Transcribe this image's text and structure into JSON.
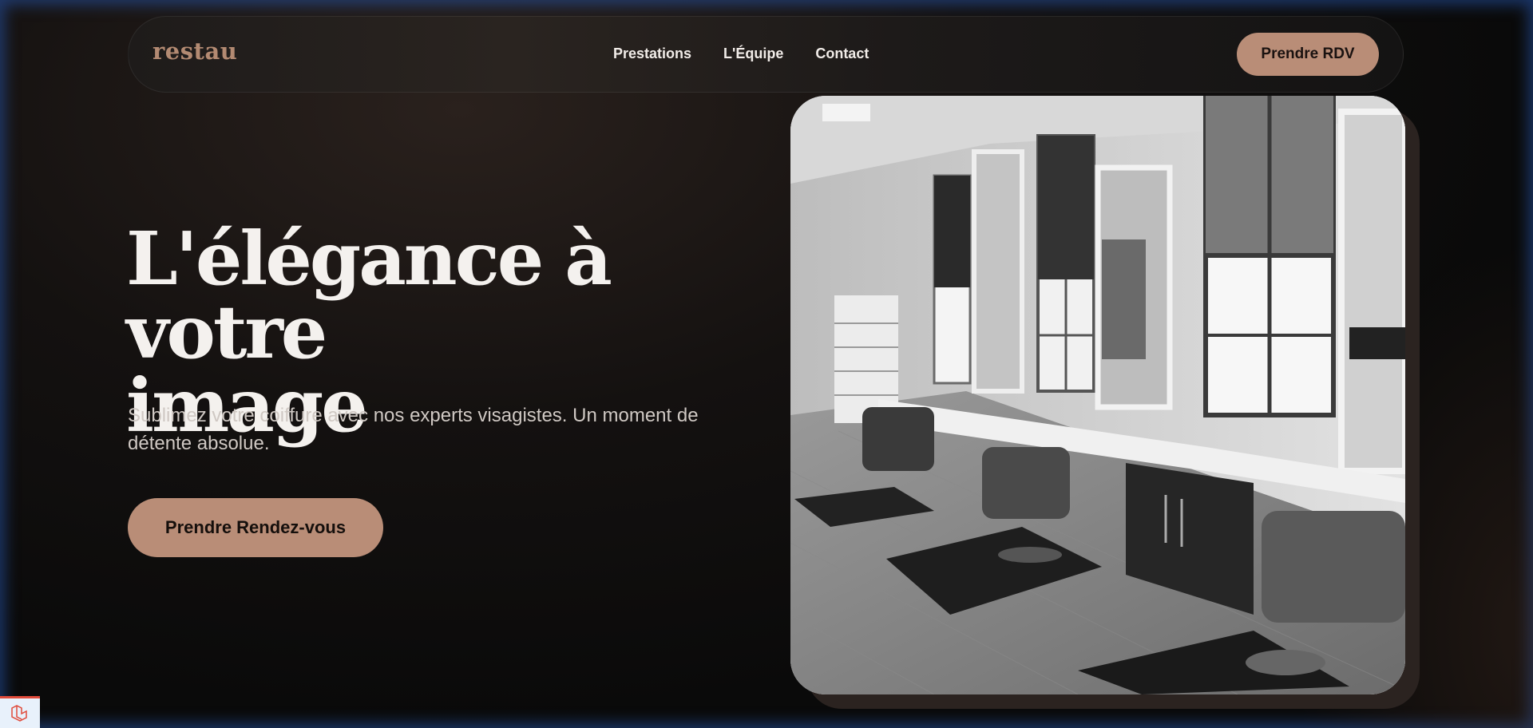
{
  "header": {
    "logo": "restau",
    "nav": [
      {
        "label": "Prestations"
      },
      {
        "label": "L'Équipe"
      },
      {
        "label": "Contact"
      }
    ],
    "cta_label": "Prendre RDV"
  },
  "hero": {
    "title_line1": "L'élégance à votre",
    "title_line2": "image",
    "subtitle_line1": "Sublimez votre coiffure avec nos experts visagistes. Un moment de",
    "subtitle_line2": "détente absolue.",
    "cta_label": "Prendre Rendez-vous"
  },
  "photo": {
    "icon": "salon-photo",
    "style": "black-and-white"
  },
  "badge": {
    "icon": "laravel-icon"
  },
  "colors": {
    "accent": "#b98d77",
    "logo": "#b38a72",
    "background": "#0b0b0b",
    "text": "#f4f1ee"
  }
}
